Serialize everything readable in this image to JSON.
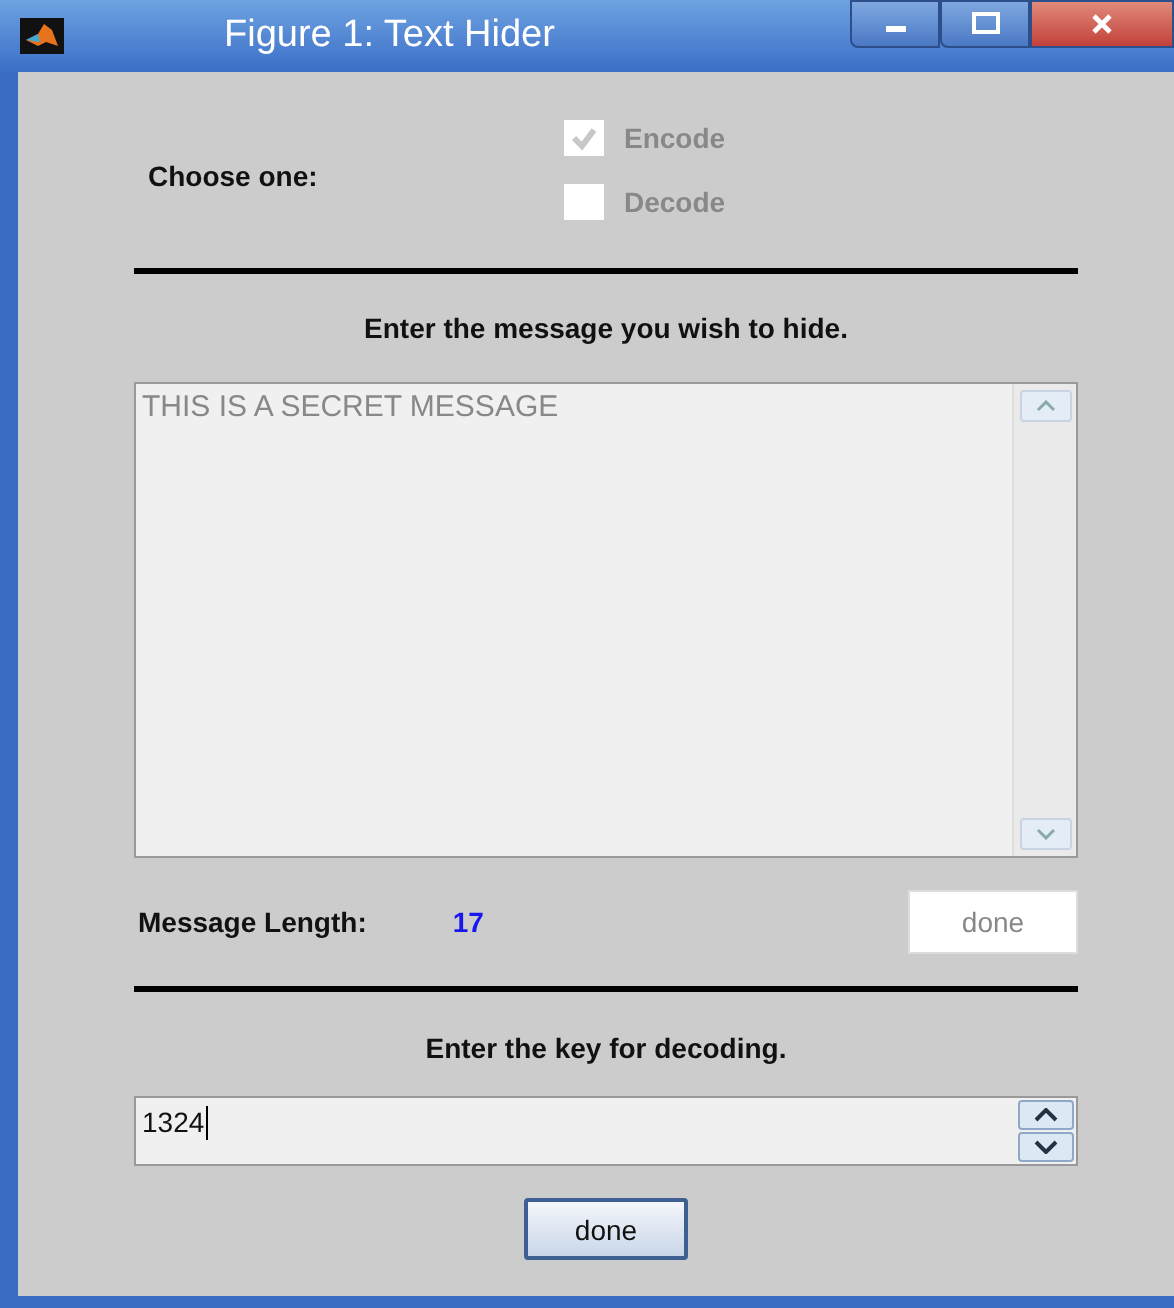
{
  "window": {
    "title": "Figure 1: Text Hider"
  },
  "mode": {
    "label": "Choose one:",
    "options": [
      {
        "label": "Encode",
        "checked": true,
        "disabled": true
      },
      {
        "label": "Decode",
        "checked": false,
        "disabled": true
      }
    ]
  },
  "message": {
    "prompt": "Enter the message you wish to hide.",
    "value": "THIS IS A SECRET MESSAGE",
    "disabled": true
  },
  "length": {
    "label": "Message Length:",
    "value": "17",
    "button": {
      "label": "done",
      "disabled": true
    }
  },
  "key": {
    "prompt": "Enter the key for decoding.",
    "value": "1324"
  },
  "done_button": {
    "label": "done",
    "disabled": false
  }
}
